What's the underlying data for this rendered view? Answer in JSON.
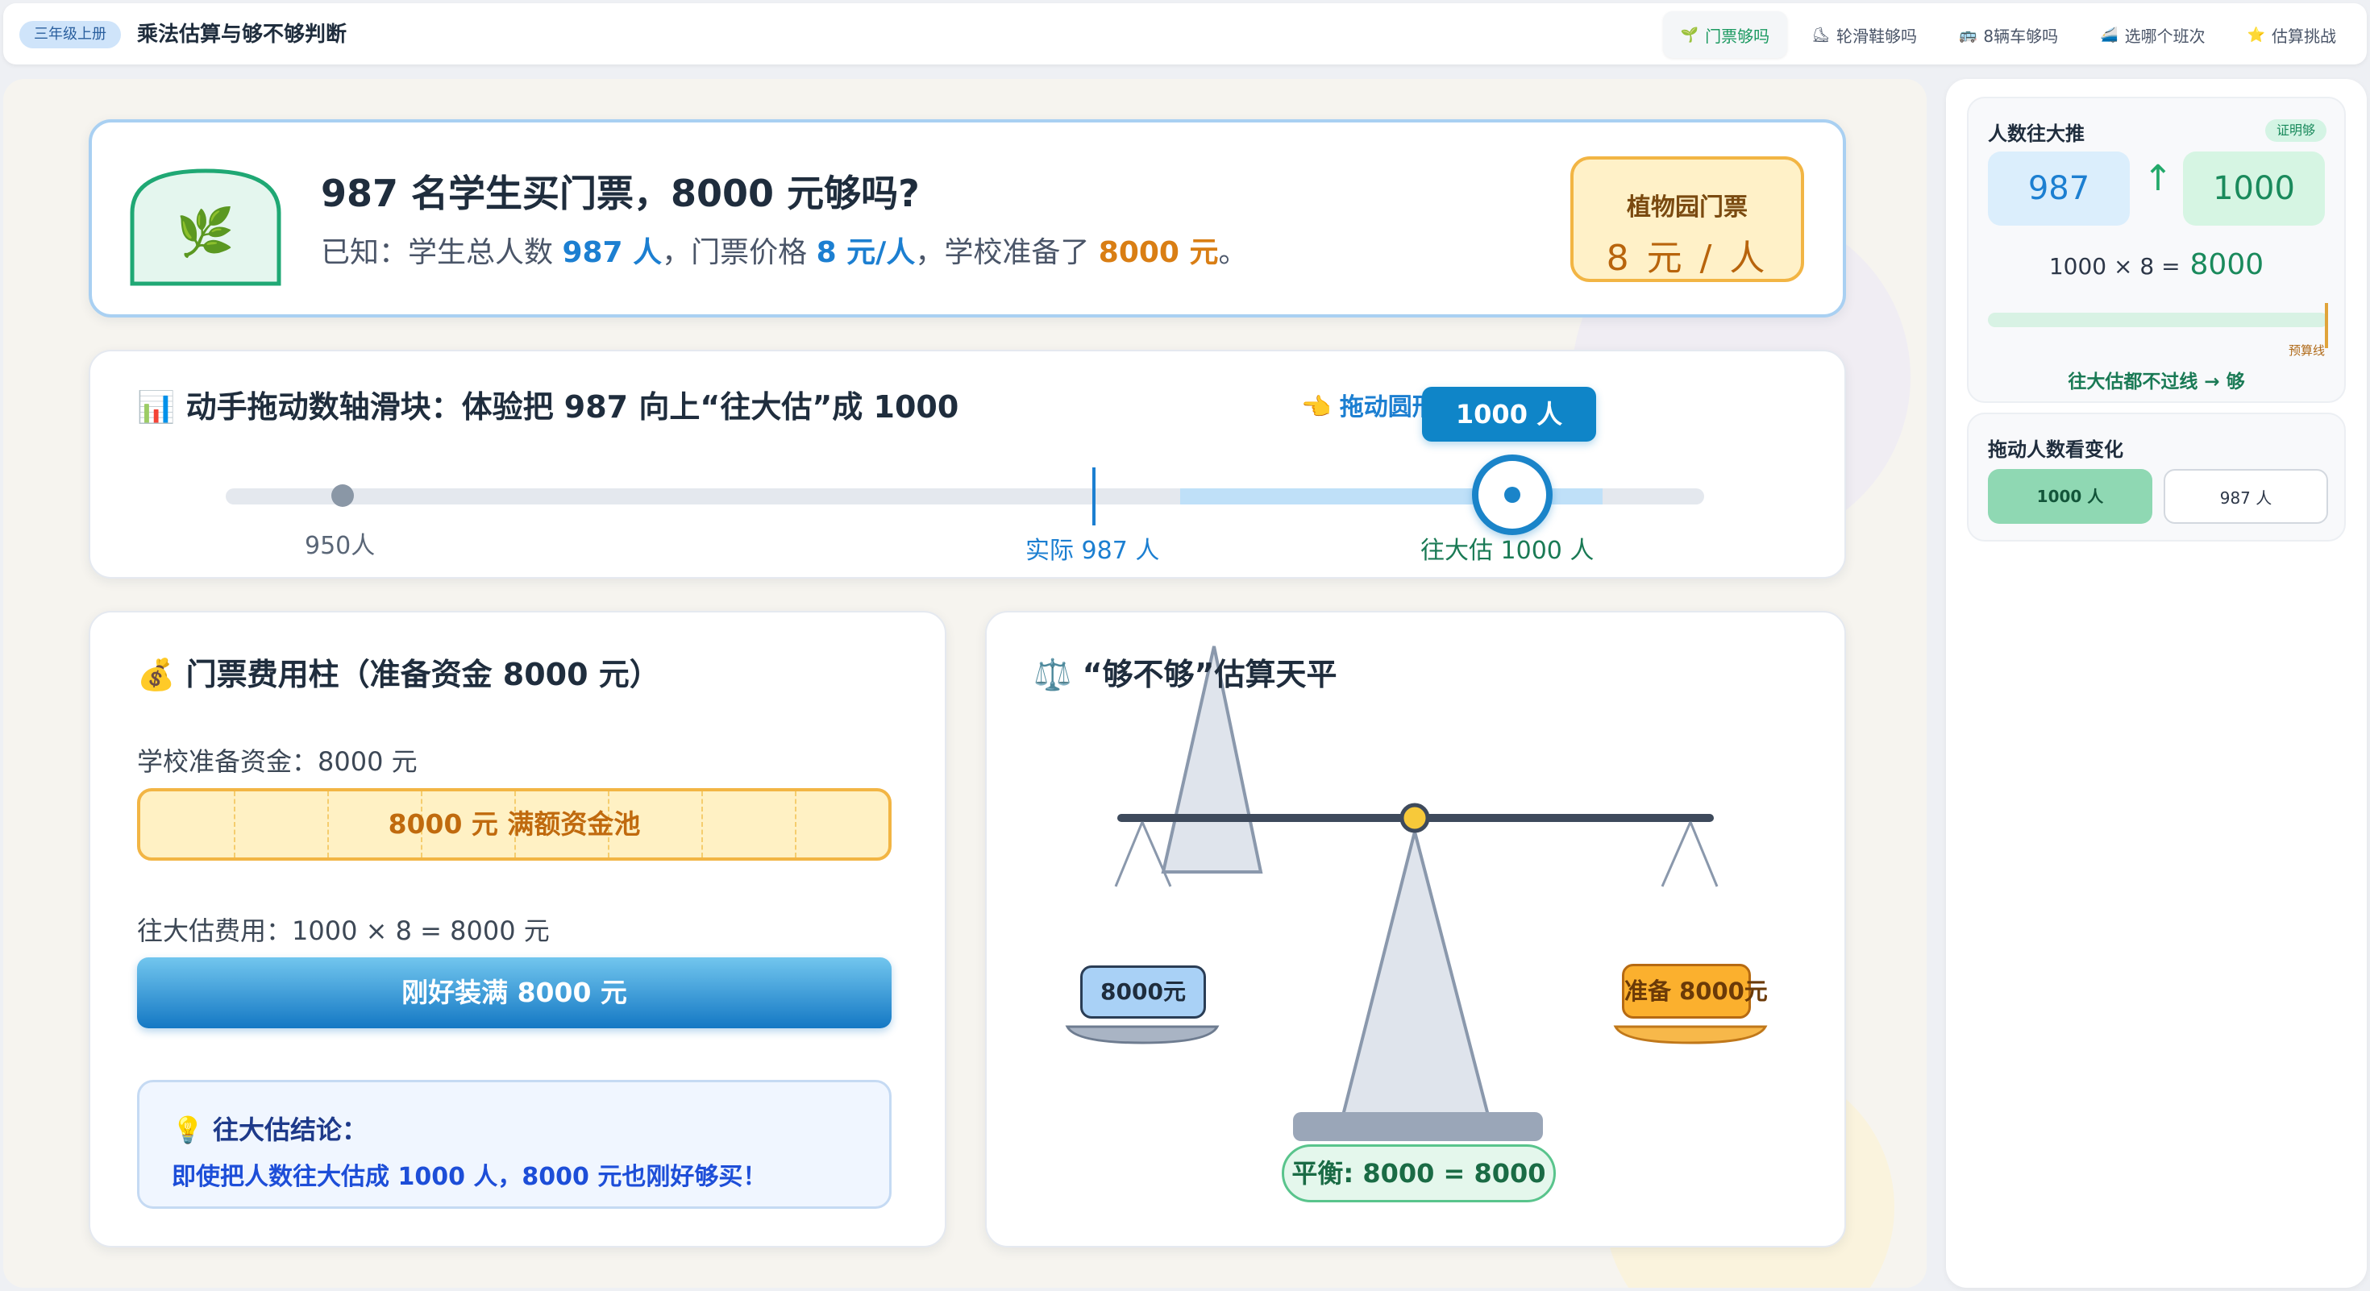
{
  "header": {
    "grade_badge": "三年级上册",
    "title": "乘法估算与够不够判断",
    "tabs": [
      {
        "icon": "🌱",
        "label": "门票够吗",
        "active": true
      },
      {
        "icon": "⛸",
        "label": "轮滑鞋够吗"
      },
      {
        "icon": "🚌",
        "label": "8辆车够吗"
      },
      {
        "icon": "🚄",
        "label": "选哪个班次"
      },
      {
        "icon": "⭐",
        "label": "估算挑战"
      }
    ]
  },
  "problem": {
    "icon": "🌿",
    "title": "987 名学生买门票，8000 元够吗?",
    "desc_prefix": "已知：学生总人数 ",
    "students": "987 人",
    "desc_mid1": "，门票价格 ",
    "price": "8 元/人",
    "desc_mid2": "，学校准备了 ",
    "budget": "8000 元",
    "desc_suffix": "。",
    "ticket_label": "植物园门票",
    "ticket_price": "8 元 / 人"
  },
  "slider": {
    "icon": "📊",
    "title": "动手拖动数轴滑块：体验把 987 向上“往大估”成 1000",
    "hint_icon": "👈",
    "hint": "拖动圆形",
    "min_label": "950人",
    "actual_label": "实际 987 人",
    "rounded_label": "往大估 1000 人",
    "bubble": "1000 人",
    "min": 950,
    "max": 1010,
    "actual": 987,
    "value": 1000
  },
  "cost": {
    "icon": "💰",
    "title": "门票费用柱（准备资金 8000 元）",
    "fund_label": "学校准备资金：8000 元",
    "fund_bar": "8000 元 满额资金池",
    "cost_label": "往大估费用：1000 × 8 = 8000 元",
    "cost_bar": "刚好装满 8000 元",
    "cost_fill_fraction": 1.0,
    "conclusion_icon": "💡",
    "conclusion_title": "往大估结论：",
    "conclusion_text": "即使把人数往大估成 1000 人，8000 元也刚好够买！"
  },
  "balance": {
    "icon": "⚖️",
    "title": "“够不够”估算天平",
    "left_label": "8000元",
    "right_label": "准备 8000元",
    "badge": "平衡: 8000 = 8000"
  },
  "side": {
    "card1_title": "人数往大推",
    "proof_badge": "证明够",
    "from": "987",
    "arrow": "↑",
    "to": "1000",
    "formula": "1000 × 8  =",
    "result": "8000",
    "budget_line_label": "预算线",
    "conclusion": "往大估都不过线 → 够",
    "card2_title": "拖动人数看变化",
    "option_a": "1000 人",
    "option_b": "987 人"
  },
  "colors": {
    "accent_blue": "#1c7fd1",
    "accent_green": "#1a8a5c",
    "accent_orange": "#d97e14"
  }
}
